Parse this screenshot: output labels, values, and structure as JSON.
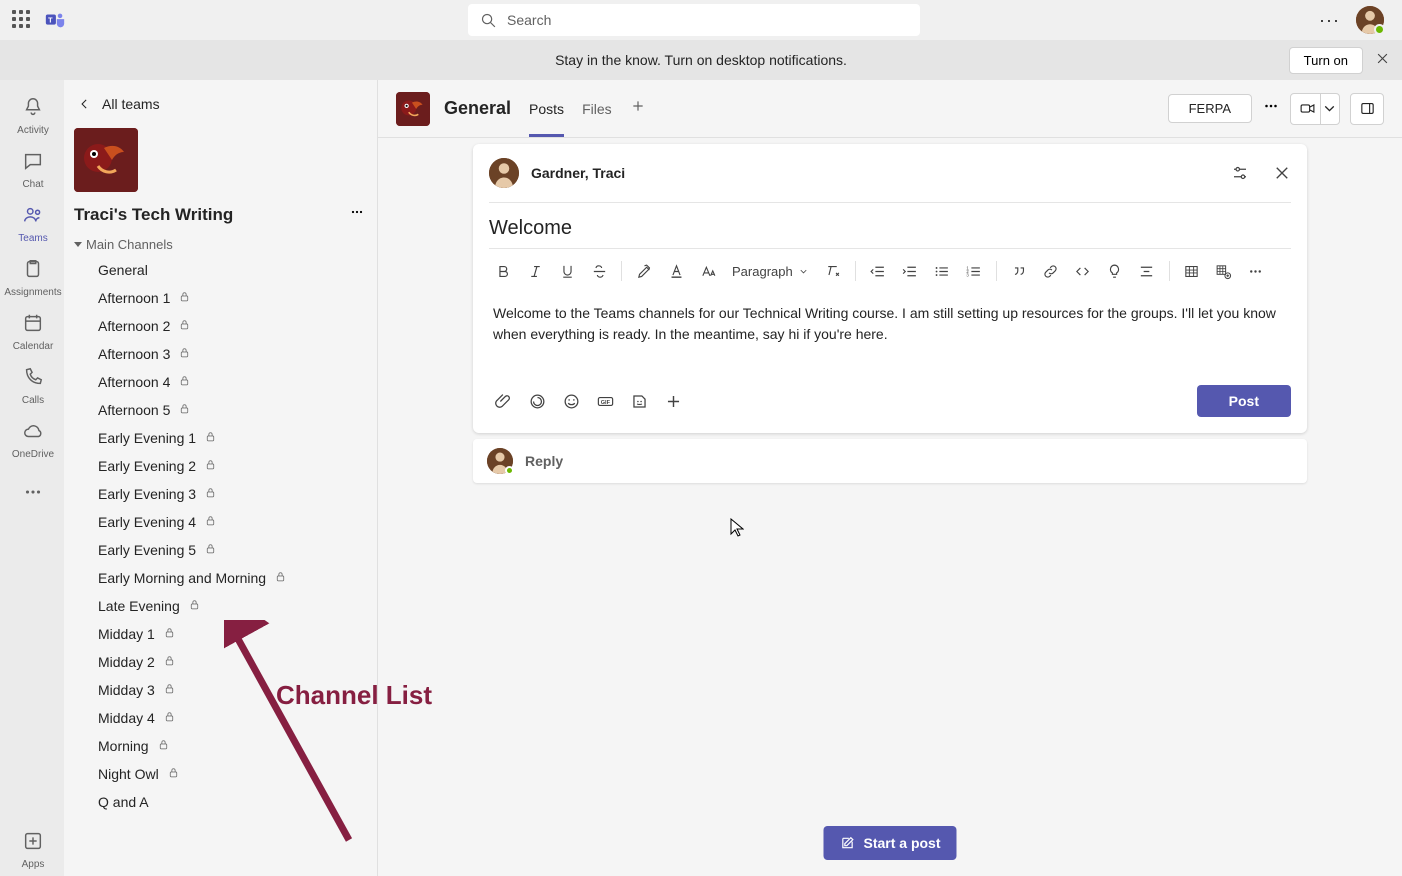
{
  "search": {
    "placeholder": "Search"
  },
  "notification": {
    "text": "Stay in the know. Turn on desktop notifications.",
    "button": "Turn on"
  },
  "rail": {
    "activity": "Activity",
    "chat": "Chat",
    "teams": "Teams",
    "assignments": "Assignments",
    "calendar": "Calendar",
    "calls": "Calls",
    "onedrive": "OneDrive",
    "apps": "Apps"
  },
  "sidebar": {
    "back_label": "All teams",
    "team_name": "Traci's Tech Writing",
    "section_label": "Main Channels",
    "channels": [
      {
        "name": "General",
        "private": false
      },
      {
        "name": "Afternoon 1",
        "private": true
      },
      {
        "name": "Afternoon 2",
        "private": true
      },
      {
        "name": "Afternoon 3",
        "private": true
      },
      {
        "name": "Afternoon 4",
        "private": true
      },
      {
        "name": "Afternoon 5",
        "private": true
      },
      {
        "name": "Early Evening 1",
        "private": true
      },
      {
        "name": "Early Evening 2",
        "private": true
      },
      {
        "name": "Early Evening 3",
        "private": true
      },
      {
        "name": "Early Evening 4",
        "private": true
      },
      {
        "name": "Early Evening 5",
        "private": true
      },
      {
        "name": "Early Morning and Morning",
        "private": true
      },
      {
        "name": "Late Evening",
        "private": true
      },
      {
        "name": "Midday 1",
        "private": true
      },
      {
        "name": "Midday 2",
        "private": true
      },
      {
        "name": "Midday 3",
        "private": true
      },
      {
        "name": "Midday 4",
        "private": true
      },
      {
        "name": "Morning",
        "private": true
      },
      {
        "name": "Night Owl",
        "private": true
      },
      {
        "name": "Q and A",
        "private": false
      }
    ]
  },
  "annotation": {
    "label": "Channel List"
  },
  "header": {
    "channel_title": "General",
    "tabs": [
      "Posts",
      "Files"
    ],
    "right_pill": "FERPA"
  },
  "compose": {
    "author": "Gardner, Traci",
    "subject": "Welcome",
    "paragraph_label": "Paragraph",
    "body": "Welcome to the Teams channels for our Technical Writing course. I am still setting up resources for the groups. I'll let you know when everything is ready. In the meantime, say hi if you're here.",
    "post_button": "Post"
  },
  "reply": {
    "label": "Reply"
  },
  "start_post": {
    "label": "Start a post"
  }
}
